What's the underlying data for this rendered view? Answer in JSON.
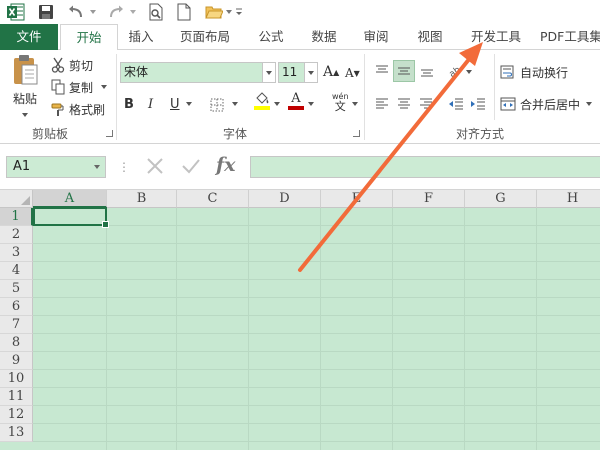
{
  "tabs": [
    {
      "label": "文件"
    },
    {
      "label": "开始"
    },
    {
      "label": "插入"
    },
    {
      "label": "页面布局"
    },
    {
      "label": "公式"
    },
    {
      "label": "数据"
    },
    {
      "label": "审阅"
    },
    {
      "label": "视图"
    },
    {
      "label": "开发工具"
    },
    {
      "label": "PDF工具集"
    }
  ],
  "clipboard": {
    "paste_label": "粘贴",
    "cut_label": "剪切",
    "copy_label": "复制",
    "format_painter_label": "格式刷",
    "group_label": "剪贴板"
  },
  "font": {
    "name_value": "宋体",
    "size_value": "11",
    "grow_label": "A",
    "shrink_label": "A",
    "bold_label": "B",
    "italic_label": "I",
    "underline_label": "U",
    "font_color_label": "A",
    "phonetic_label": "wén",
    "group_label": "字体"
  },
  "alignment": {
    "wrap_text_label": "自动换行",
    "merge_center_label": "合并后居中",
    "group_label": "对齐方式"
  },
  "formula_bar": {
    "name_box_value": "A1",
    "fx_label": "fx"
  },
  "sheet": {
    "columns": [
      "A",
      "B",
      "C",
      "D",
      "E",
      "F",
      "G",
      "H"
    ],
    "rows": [
      "1",
      "2",
      "3",
      "4",
      "5",
      "6",
      "7",
      "8",
      "9",
      "10",
      "11",
      "12",
      "13"
    ],
    "active_cell": "A1"
  },
  "colors": {
    "excel_green": "#217346",
    "cell_background": "#c7e8d1",
    "annotation_arrow": "#f26b3a",
    "fill_color_bar": "#ffff00",
    "font_color_bar": "#c00000"
  }
}
